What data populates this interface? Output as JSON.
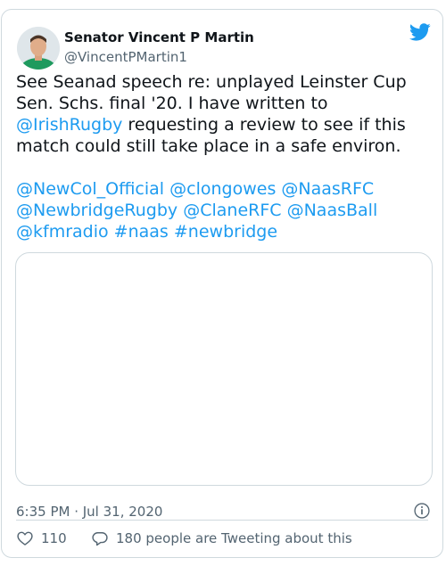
{
  "author": {
    "name": "Senator Vincent P Martin",
    "handle": "@VincentPMartin1"
  },
  "tweet": {
    "line1": "See Seanad speech re: unplayed Leinster Cup",
    "line2": "Sen. Schs. final '20. I have written to",
    "line3_mention": "@IrishRugby",
    "line3_rest": " requesting a review to see if this",
    "line4": "match could still take place in a safe environ.",
    "mentions_row1": [
      "@NewCol_Official",
      "@clongowes",
      "@NaasRFC"
    ],
    "mentions_row2": [
      "@NewbridgeRugby",
      "@ClaneRFC",
      "@NaasBall"
    ],
    "mentions_row3": [
      "@kfmradio",
      "#naas",
      "#newbridge"
    ]
  },
  "meta": {
    "timestamp": "6:35 PM · Jul 31, 2020",
    "like_count": "110",
    "reply_text": "180 people are Tweeting about this"
  },
  "icons": {
    "brand": "twitter-bird-icon",
    "info": "info-icon",
    "like": "heart-icon",
    "reply": "speech-bubble-icon"
  },
  "colors": {
    "accent": "#1d9bf0",
    "text": "#0f1419",
    "muted": "#536471",
    "border": "#cfd9de"
  }
}
